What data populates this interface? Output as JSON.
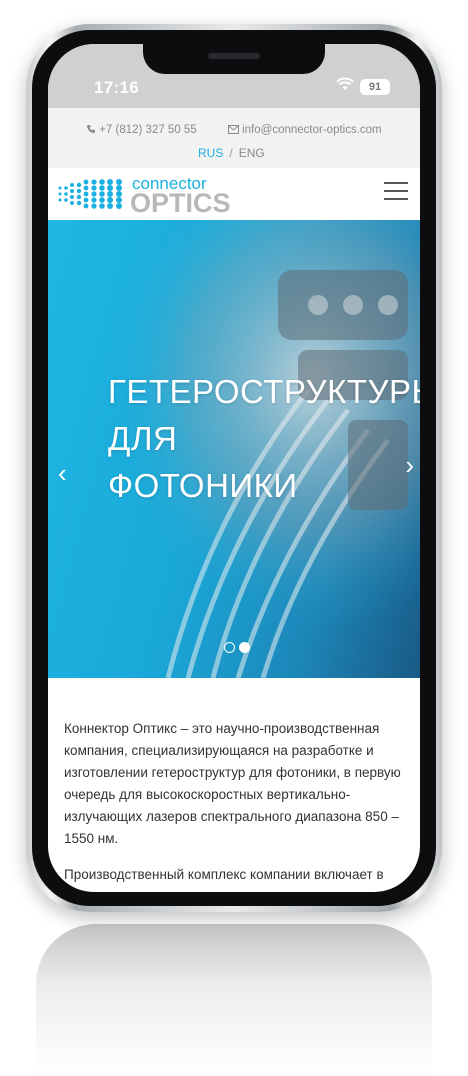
{
  "status_bar": {
    "time": "17:16",
    "battery": "91"
  },
  "topbar": {
    "phone": "+7 (812) 327 50 55",
    "email": "info@connector-optics.com",
    "lang_active": "RUS",
    "lang_separator": "/",
    "lang_other": "ENG"
  },
  "header": {
    "logo_top": "connector",
    "logo_bottom": "OPTICS"
  },
  "hero": {
    "line1": "ГЕТЕРОСТРУКТУРЫ",
    "line2": "ДЛЯ",
    "line3": "ФОТОНИКИ",
    "prev_symbol": "‹",
    "next_symbol": "›"
  },
  "content": {
    "paragraph1": "Коннектор Оптикс – это научно-производственная компания, специализирующаяся на разработке и изготовлении гетероструктур для фотоники, в первую очередь для высокоскоростных вертикально-излучающих лазеров спектрального диапазона 850 – 1550 нм.",
    "paragraph2": "Производственный комплекс компании включает в себя современную технологическую установку"
  },
  "colors": {
    "accent": "#1bb0e0",
    "hero": "#1fb7e3",
    "logo_gray": "#b8b8b8"
  },
  "icons": [
    "phone-icon",
    "mail-icon",
    "wifi-icon",
    "battery-icon",
    "menu-icon",
    "chevron-left-icon",
    "chevron-right-icon"
  ]
}
